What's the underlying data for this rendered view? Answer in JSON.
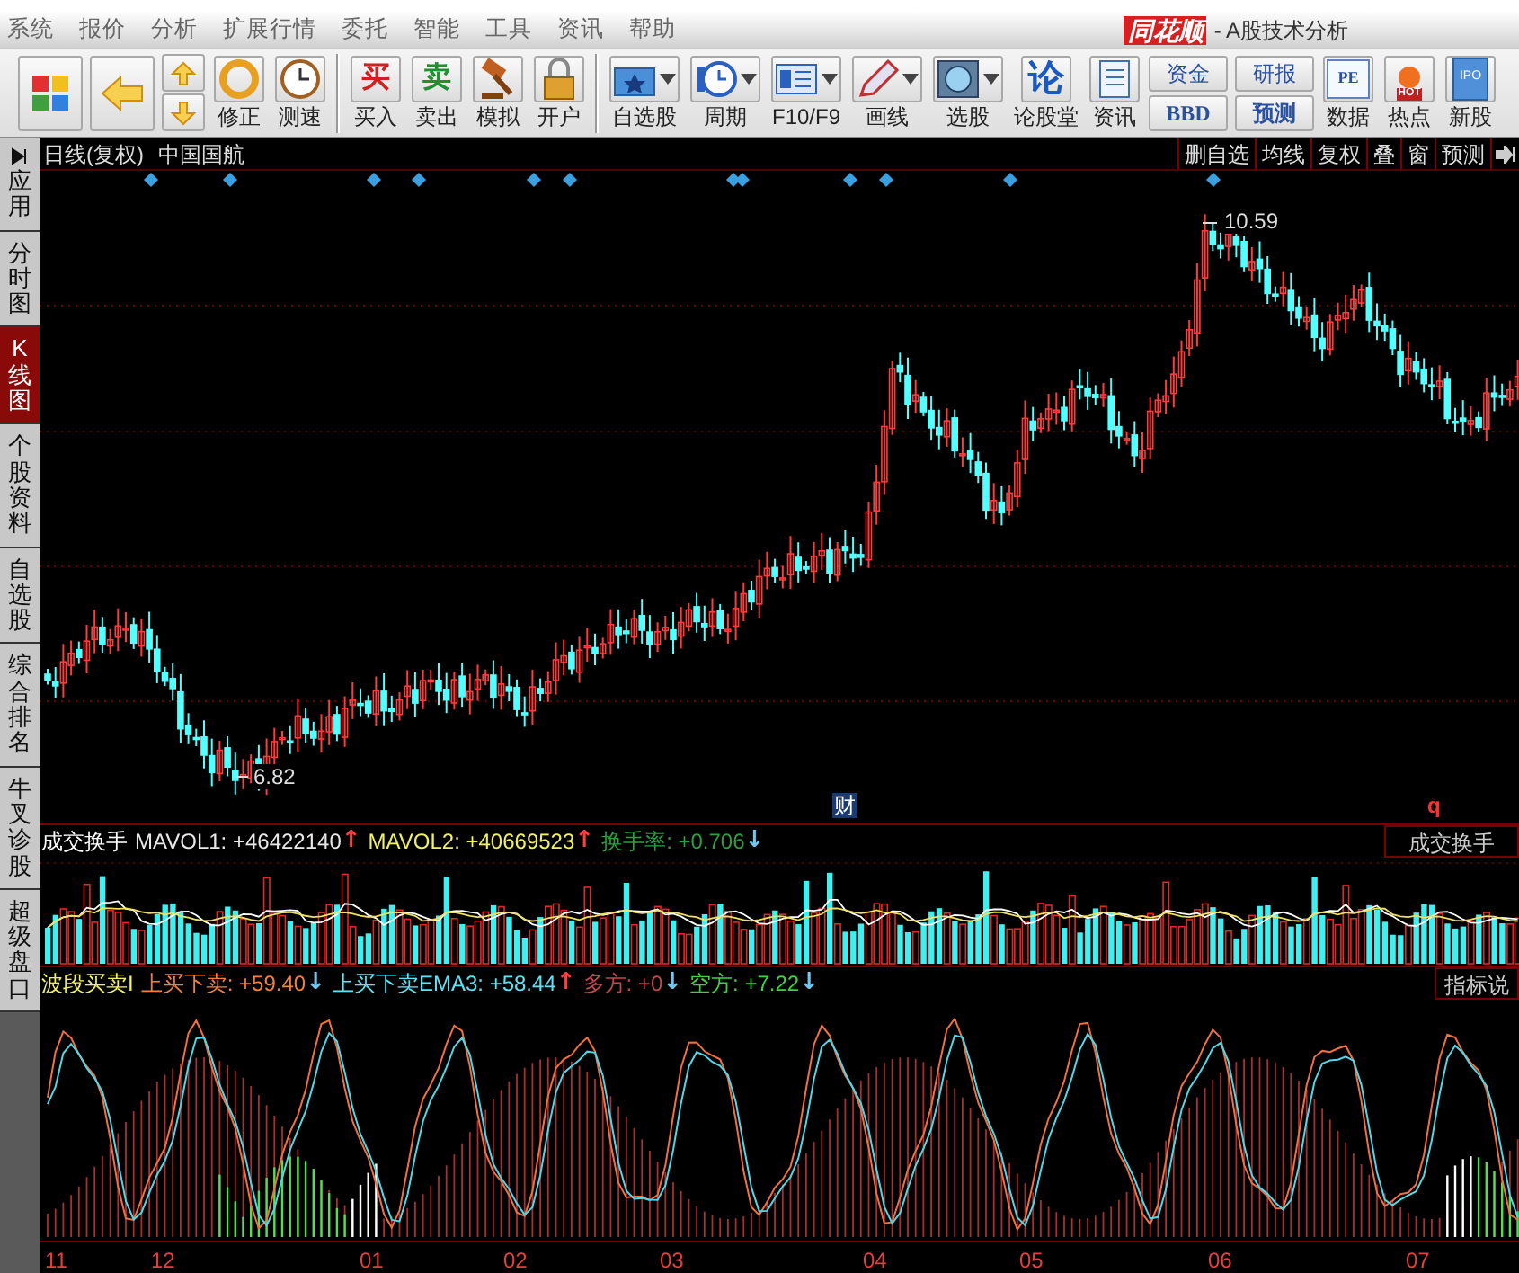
{
  "menu": [
    {
      "label": "系统"
    },
    {
      "label": "报价"
    },
    {
      "label": "分析"
    },
    {
      "label": "扩展行情"
    },
    {
      "label": "委托"
    },
    {
      "label": "智能"
    },
    {
      "label": "工具"
    },
    {
      "label": "资讯"
    },
    {
      "label": "帮助"
    }
  ],
  "app_title": {
    "logo": "同花顺",
    "text": "- A股技术分析"
  },
  "toolbar": [
    {
      "kind": "tile"
    },
    {
      "kind": "tile"
    },
    {
      "kind": "updown"
    },
    {
      "kind": "tile",
      "label": "修正"
    },
    {
      "kind": "tile",
      "label": "测速"
    },
    {
      "kind": "separator"
    },
    {
      "kind": "tile",
      "label": "买入",
      "glyph": "买"
    },
    {
      "kind": "tile",
      "label": "卖出",
      "glyph": "卖"
    },
    {
      "kind": "tile",
      "label": "模拟"
    },
    {
      "kind": "tile",
      "label": "开户"
    },
    {
      "kind": "separator"
    },
    {
      "kind": "dropdown",
      "label": "自选股"
    },
    {
      "kind": "dropdown",
      "label": "周期"
    },
    {
      "kind": "dropdown",
      "label": "F10/F9"
    },
    {
      "kind": "dropdown",
      "label": "画线"
    },
    {
      "kind": "dropdown",
      "label": "选股"
    },
    {
      "kind": "tile",
      "label": "论股堂",
      "glyph": "论"
    },
    {
      "kind": "tile",
      "label": "资讯"
    },
    {
      "kind": "pair",
      "top": "资金",
      "bottom": "BBD"
    },
    {
      "kind": "pair",
      "top": "研报",
      "bottom": "预测"
    },
    {
      "kind": "tile",
      "label": "数据",
      "glyph": "PE"
    },
    {
      "kind": "tile",
      "label": "热点",
      "glyph": "HOT"
    },
    {
      "kind": "tile",
      "label": "新股",
      "glyph": "IPO"
    }
  ],
  "sidebar": {
    "tabs": [
      {
        "label": "应用",
        "selected": false
      },
      {
        "label": "分时图",
        "selected": false
      },
      {
        "label": "K线图",
        "selected": true
      },
      {
        "label": "个股资料",
        "selected": false
      },
      {
        "label": "自选股",
        "selected": false
      },
      {
        "label": "综合排名",
        "selected": false
      },
      {
        "label": "牛叉诊股",
        "selected": false
      },
      {
        "label": "超级盘口",
        "selected": false
      }
    ]
  },
  "chart_header": {
    "period": "日线(复权)",
    "stock": "中国国航",
    "buttons": [
      {
        "label": "删自选"
      },
      {
        "label": "均线"
      },
      {
        "label": "复权"
      },
      {
        "label": "叠"
      },
      {
        "label": "窗"
      },
      {
        "label": "预测"
      }
    ]
  },
  "price_chart": {
    "high_label": "10.59",
    "low_label": "6.82",
    "markers": [
      {
        "kind": "finance",
        "label": "财"
      },
      {
        "kind": "event",
        "label": "q"
      }
    ]
  },
  "volume_panel": {
    "title": "成交换手",
    "readings": [
      {
        "text": "MAVOL1: +46422140",
        "color": "#e8e8e8",
        "arrow": {
          "symbol": "↑",
          "color": "#ff4040"
        }
      },
      {
        "text": "MAVOL2: +40669523",
        "color": "#f0f060",
        "arrow": {
          "symbol": "↑",
          "color": "#ff4040"
        }
      },
      {
        "text": "换手率: +0.706",
        "color": "#2e9e40",
        "arrow": {
          "symbol": "↓",
          "color": "#70c8f0"
        }
      }
    ],
    "button": "成交换手"
  },
  "indicator_panel": {
    "title": "波段买卖I",
    "readings": [
      {
        "text": "上买下卖: +59.40",
        "color": "#f08040",
        "arrow": {
          "symbol": "↓",
          "color": "#70c8f0"
        }
      },
      {
        "text": "上买下卖EMA3: +58.44",
        "color": "#60e0f0",
        "arrow": {
          "symbol": "↑",
          "color": "#ff4040"
        }
      },
      {
        "text": "多方: +0",
        "color": "#c04848",
        "arrow": {
          "symbol": "↓",
          "color": "#70c8f0"
        }
      },
      {
        "text": "空方: +7.22",
        "color": "#40d040",
        "arrow": {
          "symbol": "↓",
          "color": "#70c8f0"
        }
      }
    ],
    "button": "指标说"
  },
  "x_axis": {
    "labels": [
      "11",
      "12",
      "01",
      "02",
      "03",
      "04",
      "05",
      "06",
      "07"
    ]
  }
}
